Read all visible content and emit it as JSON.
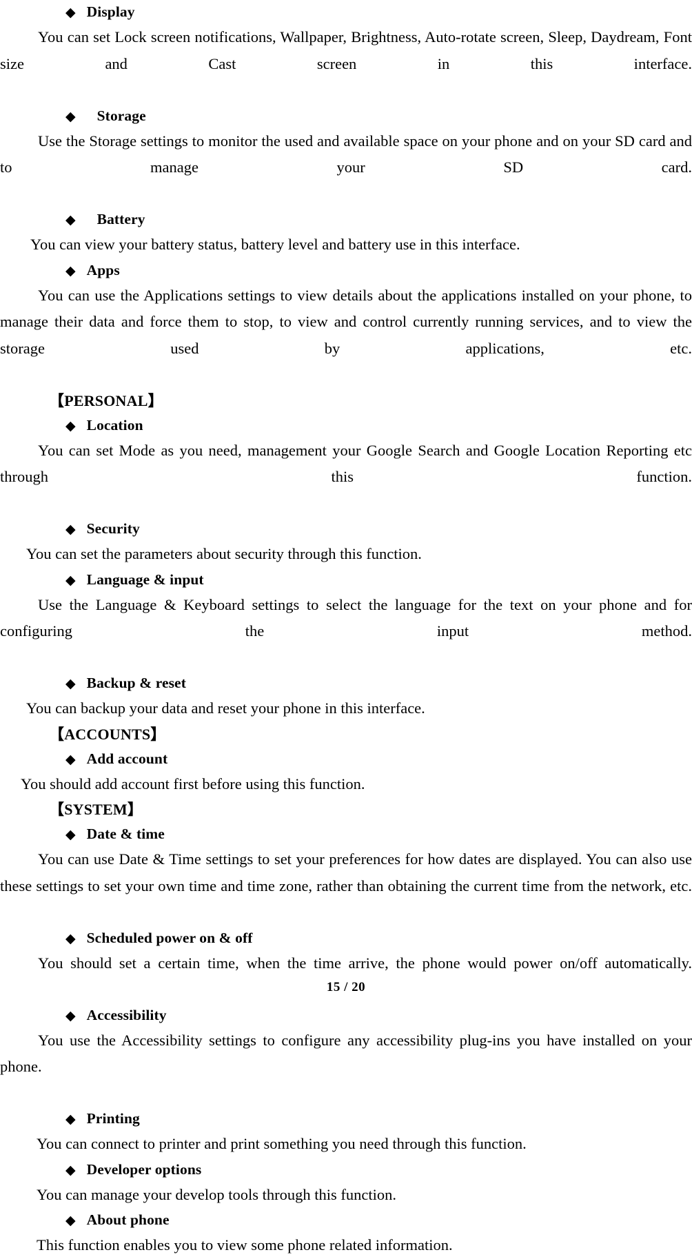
{
  "document": {
    "page_footer": "15 / 20",
    "bullet_glyph": "◆",
    "blocks": [
      {
        "kind": "heading",
        "text": "Display"
      },
      {
        "kind": "paragraph",
        "text": "You can set Lock screen notifications, Wallpaper, Brightness, Auto-rotate screen, Sleep, Daydream, Font size and Cast screen in this interface."
      },
      {
        "kind": "heading",
        "text": "Storage"
      },
      {
        "kind": "paragraph",
        "text": "Use the Storage settings to monitor the used and available space on your phone and on your SD card and to manage your SD card."
      },
      {
        "kind": "heading",
        "text": "Battery"
      },
      {
        "kind": "paragraph",
        "text": "You can view your battery status, battery level and battery use in this interface."
      },
      {
        "kind": "heading",
        "text": "Apps"
      },
      {
        "kind": "paragraph",
        "text": "You can use the Applications settings to view details about the applications installed on your phone, to manage their data and force them to stop, to view and control currently running services, and to view the storage used by applications, etc."
      },
      {
        "kind": "group",
        "text": "【PERSONAL】"
      },
      {
        "kind": "heading",
        "text": "Location"
      },
      {
        "kind": "paragraph",
        "text": "You can set Mode as you need, management your Google Search and Google Location Reporting etc through this function."
      },
      {
        "kind": "heading",
        "text": "Security"
      },
      {
        "kind": "paragraph",
        "text": "You can set the parameters about security through this function."
      },
      {
        "kind": "heading",
        "text": "Language & input"
      },
      {
        "kind": "paragraph",
        "text": "Use the Language & Keyboard settings to select the language for the text on your phone and for configuring the input method."
      },
      {
        "kind": "heading",
        "text": "Backup & reset"
      },
      {
        "kind": "paragraph",
        "text": "You can backup your data and reset your phone in this interface."
      },
      {
        "kind": "group",
        "text": "【ACCOUNTS】"
      },
      {
        "kind": "heading",
        "text": "Add account"
      },
      {
        "kind": "paragraph",
        "text": "You should add account first before using this function."
      },
      {
        "kind": "group",
        "text": "【SYSTEM】"
      },
      {
        "kind": "heading",
        "text": "Date & time"
      },
      {
        "kind": "paragraph",
        "text": "You can use Date & Time settings to set your preferences for how dates are displayed. You can also use these settings to set your own time and time zone, rather than obtaining the current time from the network, etc."
      },
      {
        "kind": "heading",
        "text": "Scheduled power on & off"
      },
      {
        "kind": "paragraph",
        "text": "You should set a certain time, when the time arrive, the phone would power on/off automatically."
      },
      {
        "kind": "heading",
        "text": "Accessibility"
      },
      {
        "kind": "paragraph",
        "text": "You use the Accessibility settings to configure any accessibility plug-ins you have installed on your phone."
      },
      {
        "kind": "heading",
        "text": "Printing"
      },
      {
        "kind": "paragraph",
        "text": "You can connect to printer and print something you need through this function."
      },
      {
        "kind": "heading",
        "text": "Developer options"
      },
      {
        "kind": "paragraph",
        "text": "You can manage your develop tools through this function."
      },
      {
        "kind": "heading",
        "text": "About phone"
      },
      {
        "kind": "paragraph",
        "text": "This function enables you to view some phone related information."
      }
    ]
  }
}
